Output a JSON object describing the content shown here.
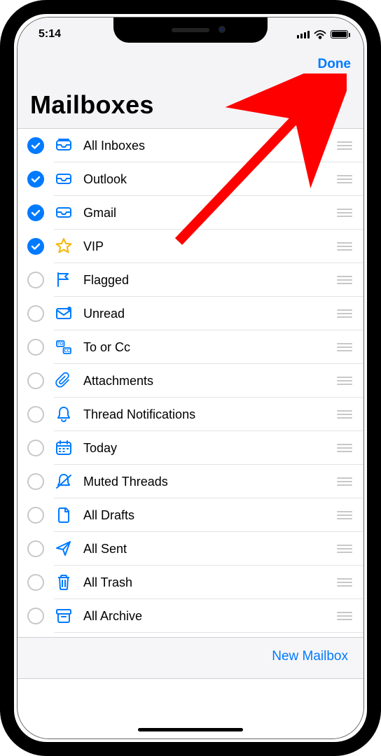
{
  "status": {
    "time": "5:14"
  },
  "nav": {
    "done_label": "Done",
    "title": "Mailboxes"
  },
  "footer": {
    "new_mailbox_label": "New Mailbox"
  },
  "mailboxes": [
    {
      "id": "all-inboxes",
      "label": "All Inboxes",
      "checked": true,
      "icon": "all-inboxes-icon"
    },
    {
      "id": "outlook",
      "label": "Outlook",
      "checked": true,
      "icon": "inbox-icon"
    },
    {
      "id": "gmail",
      "label": "Gmail",
      "checked": true,
      "icon": "inbox-icon"
    },
    {
      "id": "vip",
      "label": "VIP",
      "checked": true,
      "icon": "star-icon"
    },
    {
      "id": "flagged",
      "label": "Flagged",
      "checked": false,
      "icon": "flag-icon"
    },
    {
      "id": "unread",
      "label": "Unread",
      "checked": false,
      "icon": "unread-icon"
    },
    {
      "id": "to-or-cc",
      "label": "To or Cc",
      "checked": false,
      "icon": "to-cc-icon"
    },
    {
      "id": "attachments",
      "label": "Attachments",
      "checked": false,
      "icon": "paperclip-icon"
    },
    {
      "id": "thread-notifications",
      "label": "Thread Notifications",
      "checked": false,
      "icon": "bell-icon"
    },
    {
      "id": "today",
      "label": "Today",
      "checked": false,
      "icon": "calendar-icon"
    },
    {
      "id": "muted-threads",
      "label": "Muted Threads",
      "checked": false,
      "icon": "bell-slash-icon"
    },
    {
      "id": "all-drafts",
      "label": "All Drafts",
      "checked": false,
      "icon": "document-icon"
    },
    {
      "id": "all-sent",
      "label": "All Sent",
      "checked": false,
      "icon": "paperplane-icon"
    },
    {
      "id": "all-trash",
      "label": "All Trash",
      "checked": false,
      "icon": "trash-icon"
    },
    {
      "id": "all-archive",
      "label": "All Archive",
      "checked": false,
      "icon": "archive-icon"
    }
  ],
  "colors": {
    "accent": "#007aff",
    "star": "#f7b500",
    "annotation": "#ff0000"
  }
}
